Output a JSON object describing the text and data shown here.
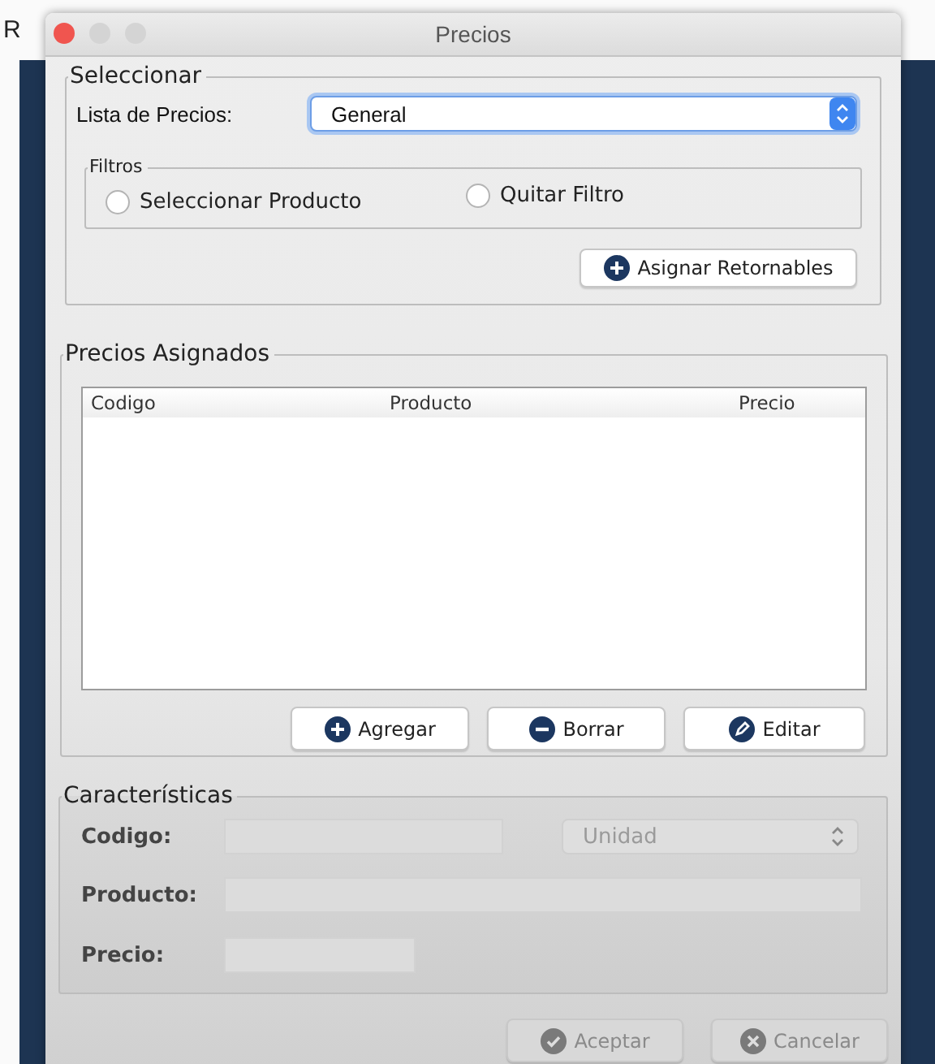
{
  "background_window": {
    "title": "R"
  },
  "dialog": {
    "title": "Precios"
  },
  "seleccionar": {
    "legend": "Seleccionar",
    "price_list_label": "Lista de Precios:",
    "price_list": {
      "value": "General",
      "focused": true
    },
    "filtros": {
      "legend": "Filtros",
      "options": [
        {
          "label": "Seleccionar Producto",
          "selected": false
        },
        {
          "label": "Quitar Filtro",
          "selected": false
        }
      ]
    },
    "assign_button": {
      "label": "Asignar Retornables"
    }
  },
  "precios_asignados": {
    "legend": "Precios Asignados",
    "table": {
      "columns": [
        "Codigo",
        "Producto",
        "Precio"
      ]
    },
    "buttons": [
      {
        "label": "Agregar"
      },
      {
        "label": "Borrar"
      },
      {
        "label": "Editar"
      }
    ]
  },
  "caracteristicas": {
    "legend": "Características",
    "disabled": true,
    "codigo_label": "Codigo:",
    "unit_select": {
      "value": "Unidad"
    },
    "producto_label": "Producto:",
    "precio_label": "Precio:"
  },
  "footer_buttons": [
    {
      "label": "Aceptar",
      "disabled": true
    },
    {
      "label": "Cancelar",
      "disabled": true
    }
  ]
}
